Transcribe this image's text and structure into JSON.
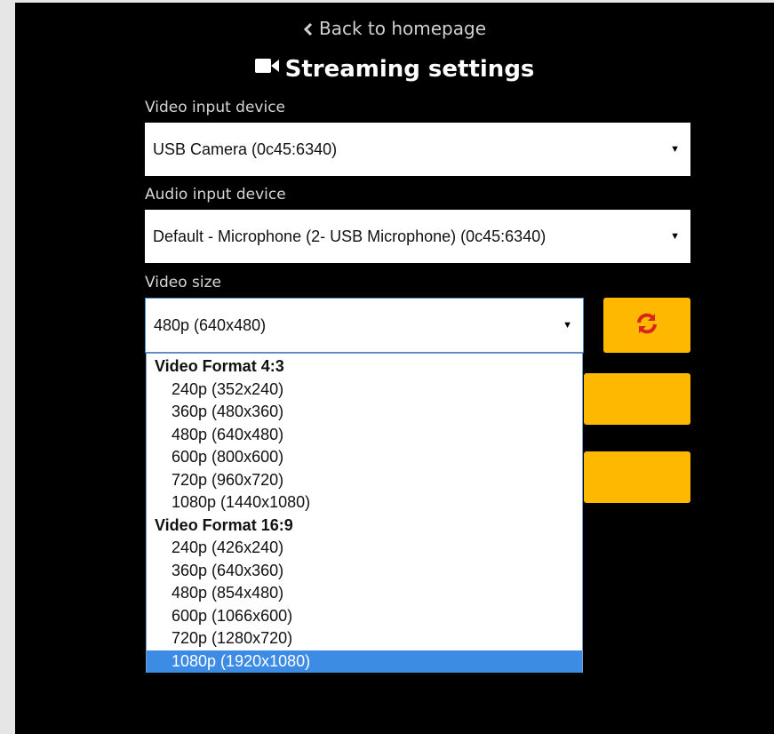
{
  "header": {
    "back_label": "Back to homepage",
    "title": "Streaming settings"
  },
  "video_input": {
    "label": "Video input device",
    "value": "USB Camera (0c45:6340)"
  },
  "audio_input": {
    "label": "Audio input device",
    "value": "Default - Microphone (2- USB Microphone) (0c45:6340)"
  },
  "video_size": {
    "label": "Video size",
    "value": "480p (640x480)",
    "groups": [
      {
        "label": "Video Format 4:3",
        "options": [
          "240p (352x240)",
          "360p (480x360)",
          "480p (640x480)",
          "600p (800x600)",
          "720p (960x720)",
          "1080p (1440x1080)"
        ]
      },
      {
        "label": "Video Format 16:9",
        "options": [
          "240p (426x240)",
          "360p (640x360)",
          "480p (854x480)",
          "600p (1066x600)",
          "720p (1280x720)",
          "1080p (1920x1080)"
        ]
      }
    ],
    "highlighted_option": "1080p (1920x1080)"
  },
  "icons": {
    "back": "chevron-left-icon",
    "title": "video-camera-icon",
    "refresh": "refresh-icon"
  },
  "colors": {
    "background": "#000000",
    "accent": "#ffb800",
    "icon_red": "#d9261c",
    "highlight": "#3c8ce6"
  }
}
